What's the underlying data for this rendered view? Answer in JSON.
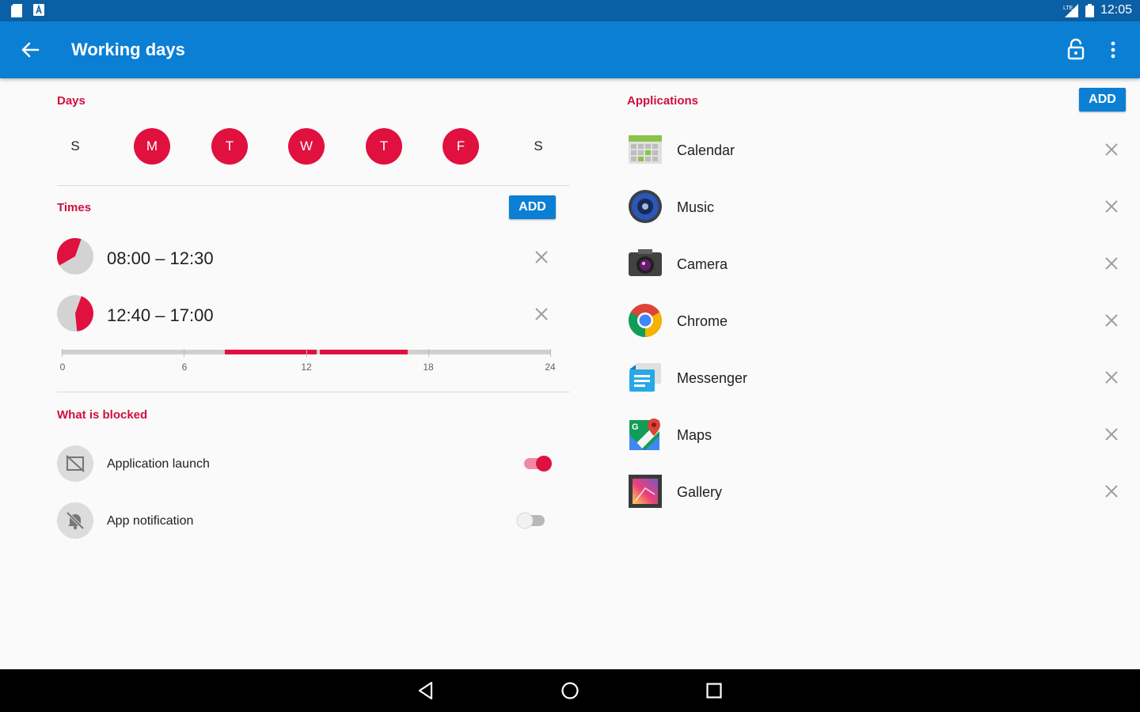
{
  "status_bar": {
    "time": "12:05",
    "network": "LTE"
  },
  "app_bar": {
    "title": "Working days"
  },
  "days": {
    "title": "Days",
    "items": [
      {
        "label": "S",
        "selected": false
      },
      {
        "label": "M",
        "selected": true
      },
      {
        "label": "T",
        "selected": true
      },
      {
        "label": "W",
        "selected": true
      },
      {
        "label": "T",
        "selected": true
      },
      {
        "label": "F",
        "selected": true
      },
      {
        "label": "S",
        "selected": false
      }
    ]
  },
  "times": {
    "title": "Times",
    "add_label": "ADD",
    "items": [
      {
        "label": "08:00 – 12:30"
      },
      {
        "label": "12:40 – 17:00"
      }
    ],
    "timeline_ticks": [
      "0",
      "6",
      "12",
      "18",
      "24"
    ]
  },
  "blocked": {
    "title": "What is blocked",
    "items": [
      {
        "label": "Application launch",
        "enabled": true,
        "icon": "app-launch-blocked-icon"
      },
      {
        "label": "App notification",
        "enabled": false,
        "icon": "notifications-off-icon"
      }
    ]
  },
  "applications": {
    "title": "Applications",
    "add_label": "ADD",
    "items": [
      {
        "name": "Calendar",
        "icon": "calendar-app-icon"
      },
      {
        "name": "Music",
        "icon": "music-app-icon"
      },
      {
        "name": "Camera",
        "icon": "camera-app-icon"
      },
      {
        "name": "Chrome",
        "icon": "chrome-app-icon"
      },
      {
        "name": "Messenger",
        "icon": "messenger-app-icon"
      },
      {
        "name": "Maps",
        "icon": "maps-app-icon"
      },
      {
        "name": "Gallery",
        "icon": "gallery-app-icon"
      }
    ]
  },
  "colors": {
    "accent": "#e0103f",
    "primary": "#0a7fd4",
    "primary_dark": "#0b5fa4"
  }
}
